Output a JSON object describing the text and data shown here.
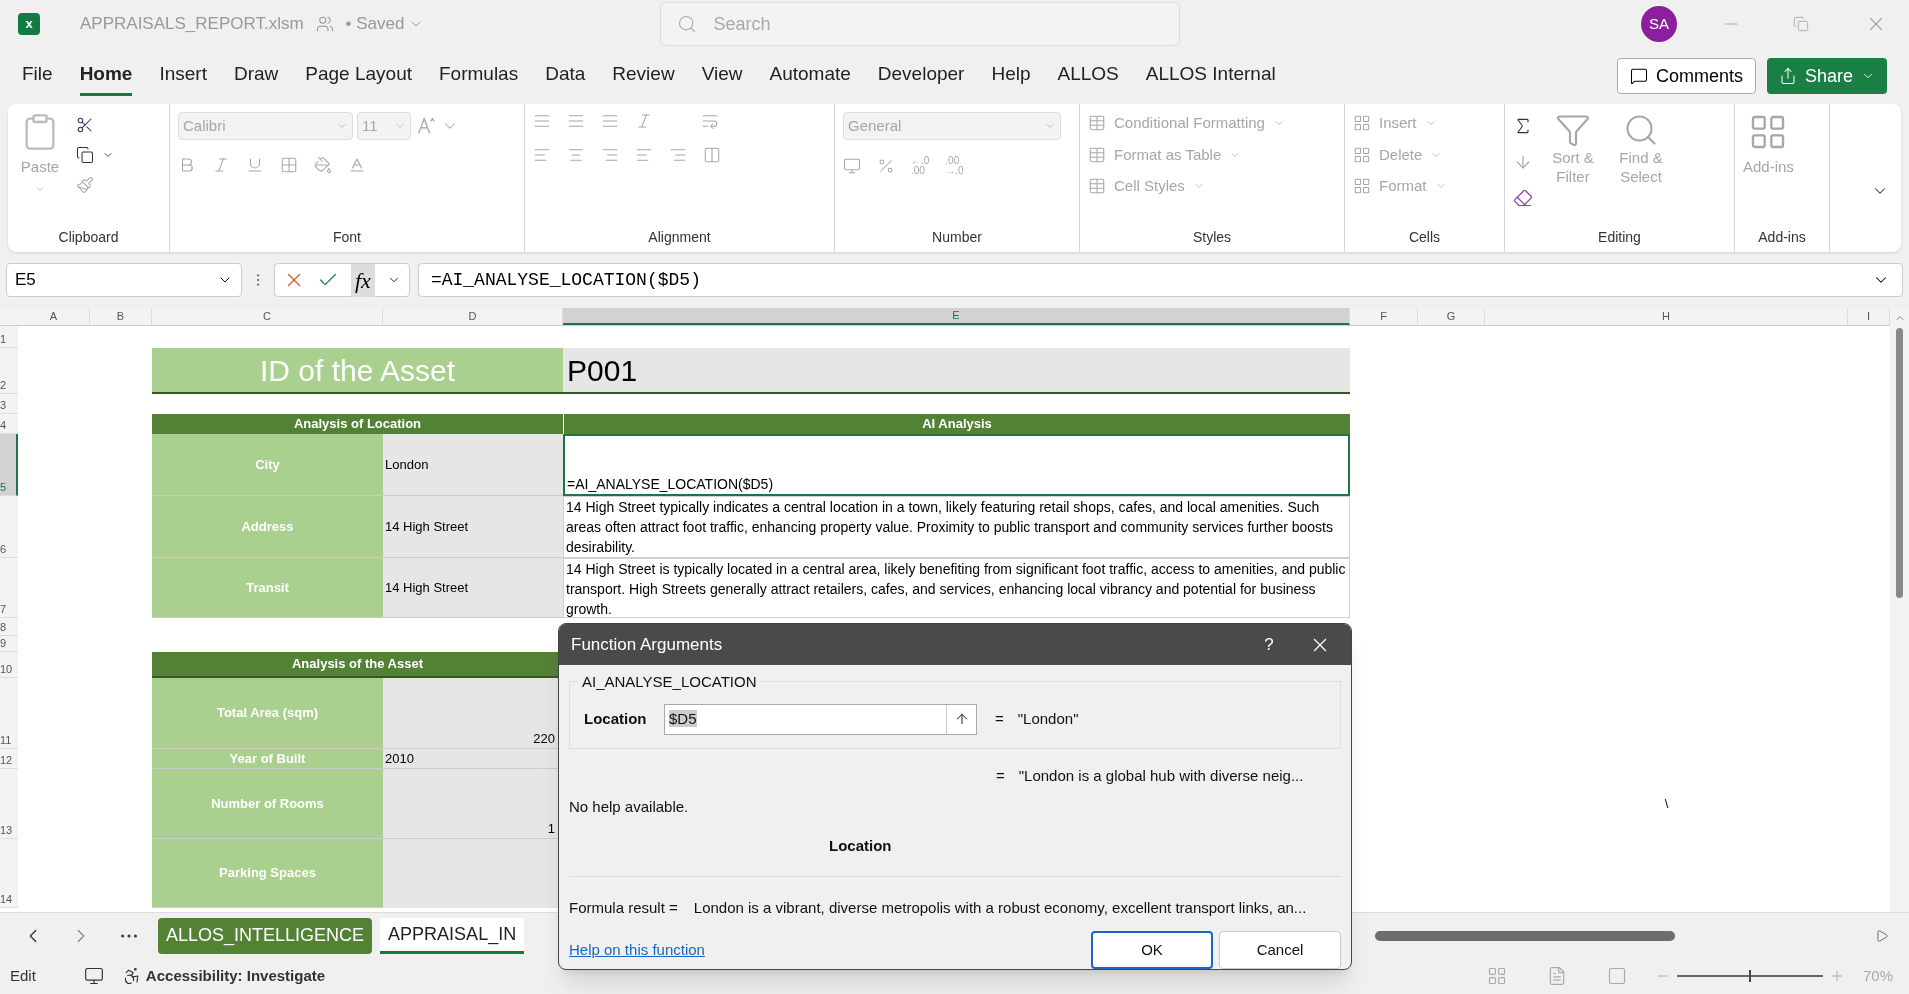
{
  "title_bar": {
    "app_letter": "x",
    "file_name": "APPRAISALS_REPORT.xlsm",
    "save_status": "• Saved",
    "search": {
      "placeholder": "Search"
    },
    "avatar": "SA"
  },
  "menu_tabs": [
    {
      "label": "File",
      "selected": false
    },
    {
      "label": "Home",
      "selected": true
    },
    {
      "label": "Insert",
      "selected": false
    },
    {
      "label": "Draw",
      "selected": false
    },
    {
      "label": "Page Layout",
      "selected": false
    },
    {
      "label": "Formulas",
      "selected": false
    },
    {
      "label": "Data",
      "selected": false
    },
    {
      "label": "Review",
      "selected": false
    },
    {
      "label": "View",
      "selected": false
    },
    {
      "label": "Automate",
      "selected": false
    },
    {
      "label": "Developer",
      "selected": false
    },
    {
      "label": "Help",
      "selected": false
    },
    {
      "label": "ALLOS",
      "selected": false
    },
    {
      "label": "ALLOS Internal",
      "selected": false
    }
  ],
  "comments_button": "Comments",
  "share_button": "Share",
  "ribbon": {
    "clipboard": {
      "label": "Clipboard",
      "paste": "Paste"
    },
    "font": {
      "label": "Font",
      "font_name": "Calibri",
      "font_size": "11"
    },
    "alignment": {
      "label": "Alignment"
    },
    "number": {
      "label": "Number",
      "format": "General",
      "increase_decimal": "←.0\n.00",
      "decrease_decimal": ".00\n→.0"
    },
    "styles": {
      "label": "Styles",
      "items": [
        "Conditional Formatting",
        "Format as Table",
        "Cell Styles"
      ]
    },
    "cells": {
      "label": "Cells",
      "items": [
        "Insert",
        "Delete",
        "Format"
      ]
    },
    "editing": {
      "label": "Editing",
      "sort": "Sort & Filter",
      "find": "Find & Select"
    },
    "addins": {
      "label": "Add-ins",
      "button": "Add-ins"
    }
  },
  "formula_bar": {
    "name_box": "E5",
    "fx_label": "fx",
    "formula": "=AI_ANALYSE_LOCATION($D5)"
  },
  "sheet": {
    "columns": [
      {
        "label": "A",
        "selected": false
      },
      {
        "label": "B",
        "selected": false
      },
      {
        "label": "C",
        "selected": false
      },
      {
        "label": "D",
        "selected": false
      },
      {
        "label": "E",
        "selected": true
      },
      {
        "label": "F",
        "selected": false
      },
      {
        "label": "G",
        "selected": false
      },
      {
        "label": "H",
        "selected": false
      },
      {
        "label": "I",
        "selected": false
      }
    ],
    "rows": [
      {
        "label": "1",
        "selected": false
      },
      {
        "label": "2",
        "selected": false
      },
      {
        "label": "3",
        "selected": false
      },
      {
        "label": "4",
        "selected": false
      },
      {
        "label": "5",
        "selected": true
      },
      {
        "label": "6",
        "selected": false
      },
      {
        "label": "7",
        "selected": false
      },
      {
        "label": "8",
        "selected": false
      },
      {
        "label": "9",
        "selected": false
      },
      {
        "label": "10",
        "selected": false
      },
      {
        "label": "11",
        "selected": false
      },
      {
        "label": "12",
        "selected": false
      },
      {
        "label": "13",
        "selected": false
      },
      {
        "label": "14",
        "selected": false
      }
    ],
    "id_label": "ID of the Asset",
    "id_value": "P001",
    "location_table": {
      "header": "Analysis of Location",
      "ai_header": "AI Analysis",
      "rows": [
        {
          "label": "City",
          "value": "London",
          "analysis": "=AI_ANALYSE_LOCATION($D5)",
          "selected": true
        },
        {
          "label": "Address",
          "value": "14 High Street",
          "analysis": "14 High Street typically indicates a central location in a town, likely featuring retail shops, cafes, and local amenities. Such areas often attract foot traffic, enhancing property value. Proximity to public transport and community services further boosts desirability.",
          "selected": false
        },
        {
          "label": "Transit",
          "value": "14 High Street",
          "analysis": "14 High Street is typically located in a central area, likely benefiting from significant foot traffic, access to amenities, and public transport. High Streets generally attract retailers, cafes, and services, enhancing local vibrancy and potential for business growth.",
          "selected": false
        }
      ]
    },
    "asset_table": {
      "header": "Analysis of the Asset",
      "rows": [
        {
          "label": "Total Area (sqm)",
          "value": "220",
          "kind": "number"
        },
        {
          "label": "Year of Built",
          "value": "2010",
          "kind": "text"
        },
        {
          "label": "Number of Rooms",
          "value": "1",
          "kind": "number"
        },
        {
          "label": "Parking Spaces"
        }
      ]
    },
    "stray_cell": "\\"
  },
  "sheet_tabs": [
    {
      "label": "ALLOS_INTELLIGENCE",
      "selected": false,
      "color": "#548235"
    },
    {
      "label": "APPRAISAL_IN",
      "selected": true
    }
  ],
  "status_bar": {
    "mode": "Edit",
    "accessibility": "Accessibility: Investigate",
    "zoom": {
      "level": 0.5,
      "reading": "70%"
    }
  },
  "dialog": {
    "title": "Function Arguments",
    "help": "?",
    "function_name": "AI_ANALYSE_LOCATION",
    "argument": {
      "label": "Location",
      "value": "$D5",
      "equals": "=",
      "result": "\"London\""
    },
    "preview_equals": "=",
    "preview": "\"London is a global hub with diverse neig...",
    "description": "No help available.",
    "argument_description": "Location",
    "formula_result_label": "Formula result =",
    "formula_result": "London is a vibrant, diverse metropolis with a robust economy, excellent transport links, an...",
    "help_link": "Help on this function",
    "buttons": [
      {
        "label": "OK",
        "focused": true
      },
      {
        "label": "Cancel",
        "focused": false
      }
    ]
  }
}
